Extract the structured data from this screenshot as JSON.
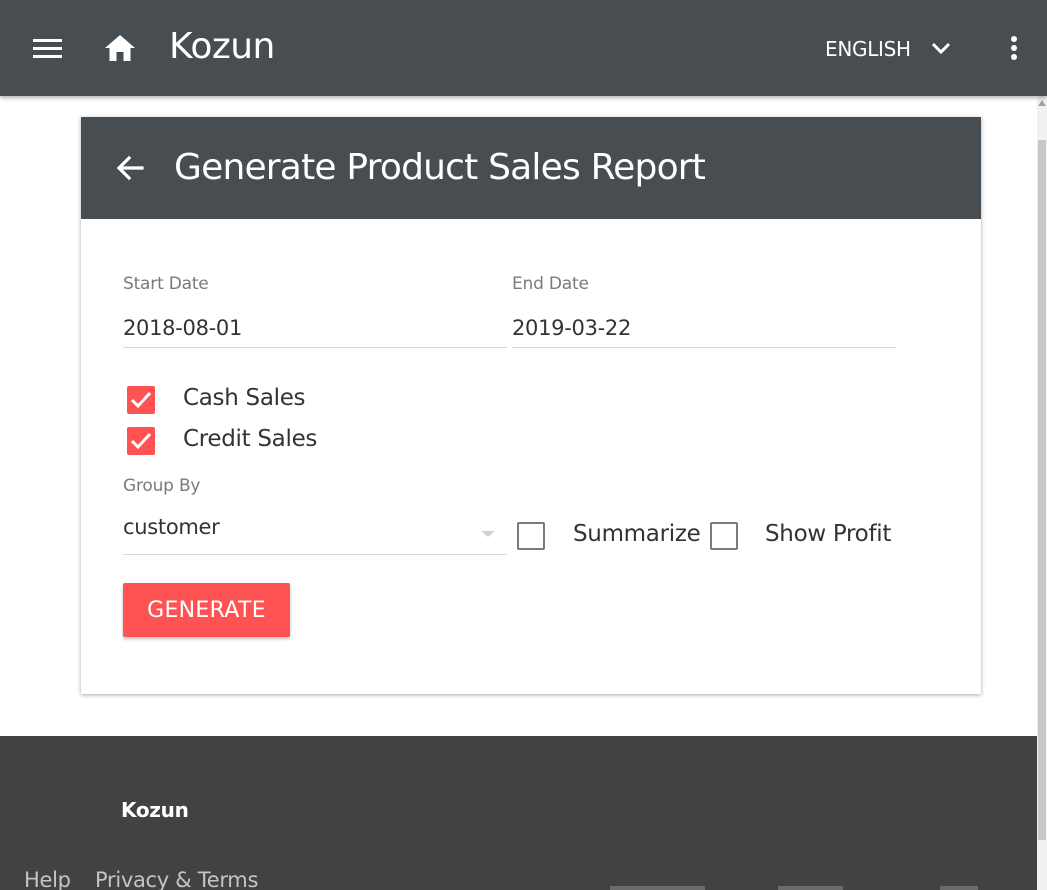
{
  "app": {
    "title": "Kozun",
    "language": "ENGLISH"
  },
  "icons": {
    "menu": "hamburger-menu",
    "home": "home",
    "language_dropdown": "chevron-down",
    "more": "more-vertical",
    "back": "arrow-left",
    "checkbox_checked": "check"
  },
  "colors": {
    "appbar": "#484d52",
    "accent": "#ff5252",
    "footer": "#424242"
  },
  "card": {
    "title": "Generate Product Sales Report"
  },
  "form": {
    "start_date": {
      "label": "Start Date",
      "value": "2018-08-01"
    },
    "end_date": {
      "label": "End Date",
      "value": "2019-03-22"
    },
    "cash_sales": {
      "label": "Cash Sales",
      "checked": true
    },
    "credit_sales": {
      "label": "Credit Sales",
      "checked": true
    },
    "group_by": {
      "label": "Group By",
      "value": "customer"
    },
    "summarize": {
      "label": "Summarize",
      "checked": false
    },
    "show_profit": {
      "label": "Show Profit",
      "checked": false
    },
    "generate_label": "GENERATE"
  },
  "footer": {
    "brand": "Kozun",
    "links": [
      "Help",
      "Privacy & Terms"
    ]
  }
}
